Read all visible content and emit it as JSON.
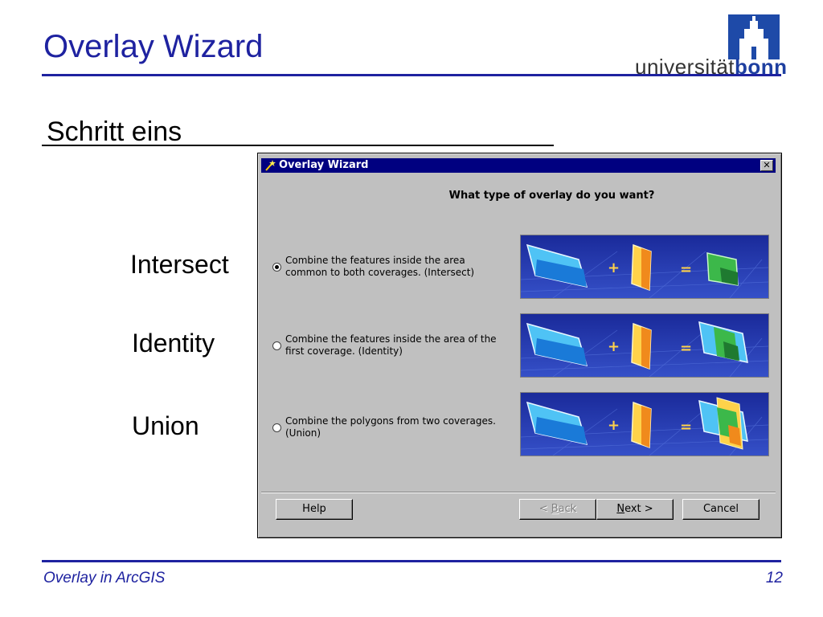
{
  "slide": {
    "title": "Overlay Wizard",
    "step_heading": "Schritt eins",
    "footer_left": "Overlay in ArcGIS",
    "page_number": "12",
    "logo_prefix": "universität",
    "logo_suffix": "bonn"
  },
  "side_labels": [
    "Intersect",
    "Identity",
    "Union"
  ],
  "dialog": {
    "title": "Overlay Wizard",
    "close_glyph": "✕",
    "question": "What type of overlay do you want?",
    "options": [
      {
        "line1": "Combine the features inside the area",
        "line2": "common to both coverages. (Intersect)",
        "selected": true
      },
      {
        "line1": "Combine the features inside the area of the",
        "line2": "first coverage. (Identity)",
        "selected": false
      },
      {
        "line1": "Combine the polygons from two coverages.",
        "line2": "(Union)",
        "selected": false
      }
    ],
    "buttons": {
      "help": "Help",
      "back_prefix": "< ",
      "back_mnemonic": "B",
      "back_rest": "ack",
      "next_mnemonic": "N",
      "next_rest": "ext >",
      "cancel": "Cancel"
    }
  },
  "colors": {
    "accent_blue": "#1e22a0",
    "titlebar": "#000080",
    "dialog_bg": "#c0c0c0",
    "illus_bg": "#2a3aa8"
  },
  "icons": {
    "title_icon": "wizard-wand-icon",
    "logo_icon": "university-building-icon"
  }
}
